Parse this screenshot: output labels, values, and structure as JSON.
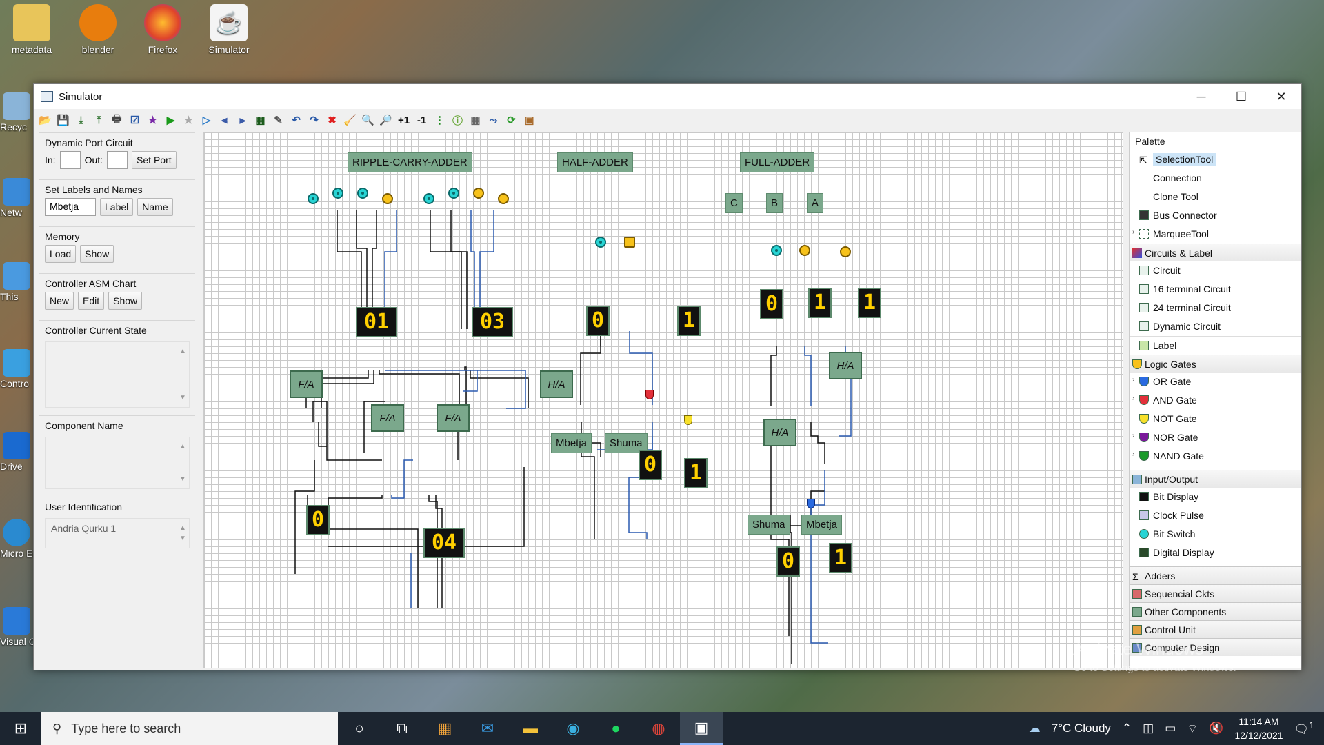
{
  "desktop": {
    "icons": [
      "metadata",
      "blender",
      "Firefox",
      "Simulator"
    ],
    "side_icons": [
      "Recyc",
      "Netw",
      "This",
      "Contro",
      "Drive",
      "Micro Ed",
      "Visual Co"
    ]
  },
  "window": {
    "title": "Simulator",
    "minimize": "─",
    "maximize": "☐",
    "close": "✕"
  },
  "toolbar": {
    "icons": [
      "open-icon",
      "save-icon",
      "export-icon",
      "import-icon",
      "print-icon",
      "check-icon",
      "star-icon",
      "run-icon",
      "star-gray-icon",
      "step-icon",
      "align-left-icon",
      "align-right-icon",
      "monitor-icon",
      "edit-icon",
      "undo-icon",
      "redo-icon",
      "delete-icon",
      "clear-icon",
      "zoom-in-icon",
      "zoom-out-icon",
      "plus-one-icon",
      "minus-one-icon",
      "timing-icon",
      "info-icon",
      "grid-icon",
      "route-icon",
      "refresh-icon",
      "chip-icon"
    ],
    "glyphs": [
      "📂",
      "💾",
      "⤓",
      "⤒",
      "🖶",
      "☑",
      "★",
      "▶",
      "★",
      "▷",
      "⫷",
      "⫸",
      "▦",
      "✎",
      "↶",
      "↷",
      "✖",
      "🧹",
      "🔍",
      "🔎",
      "+1",
      "-1",
      "⋮",
      "ⓘ",
      "▦",
      "⤳",
      "⟳",
      "▣"
    ],
    "colors": [
      "#c9a04a",
      "#3a6aa8",
      "#3a7a3a",
      "#3a7a3a",
      "#444",
      "#2a5aa8",
      "#7a2aa8",
      "#1a9a1a",
      "#aaa",
      "#2a7ac8",
      "#3a5aa8",
      "#3a5aa8",
      "#1a5a1a",
      "#555",
      "#2a5aa8",
      "#2a5aa8",
      "#e02020",
      "#d0a020",
      "#2a5aa8",
      "#2a5aa8",
      "#111",
      "#111",
      "#1a8a1a",
      "#6aa83a",
      "#666",
      "#2a5aa8",
      "#2a9a2a",
      "#a86a2a"
    ]
  },
  "left": {
    "dynamic_port": {
      "title": "Dynamic Port Circuit",
      "in_label": "In:",
      "in_value": "",
      "out_label": "Out:",
      "out_value": "",
      "set_port": "Set Port"
    },
    "labels": {
      "title": "Set Labels and Names",
      "value": "Mbetja",
      "label_btn": "Label",
      "name_btn": "Name"
    },
    "memory": {
      "title": "Memory",
      "load": "Load",
      "show": "Show"
    },
    "asm": {
      "title": "Controller ASM Chart",
      "new": "New",
      "edit": "Edit",
      "show": "Show"
    },
    "state": {
      "title": "Controller Current State",
      "value": ""
    },
    "component": {
      "title": "Component Name",
      "value": ""
    },
    "user": {
      "title": "User Identification",
      "value": "Andria Qurku 1"
    }
  },
  "canvas": {
    "labels": {
      "rca": "RIPPLE-CARRY-ADDER",
      "ha": "HALF-ADDER",
      "fa": "FULL-ADDER",
      "c": "C",
      "b": "B",
      "a": "A",
      "ha_out1": "Mbetja",
      "ha_out2": "Shuma",
      "fa_out1": "Shuma",
      "fa_out2": "Mbetja"
    },
    "displays": {
      "rca_in1": "01",
      "rca_in2": "03",
      "rca_carry": "0",
      "rca_sum": "04",
      "ha_in1": "0",
      "ha_in2": "1",
      "ha_out1": "0",
      "ha_out2": "1",
      "fa_in1": "0",
      "fa_in2": "1",
      "fa_in3": "1",
      "fa_out1": "0",
      "fa_out2": "1"
    },
    "blocks": {
      "fa": "F/A",
      "ha": "H/A"
    }
  },
  "palette": {
    "title": "Palette",
    "tools": [
      "SelectionTool",
      "Connection",
      "Clone Tool",
      "Bus Connector",
      "MarqueeTool"
    ],
    "circuits": {
      "title": "Circuits & Label",
      "items": [
        "Circuit",
        "16 terminal Circuit",
        "24 terminal Circuit",
        "Dynamic Circuit",
        "Label"
      ]
    },
    "gates": {
      "title": "Logic Gates",
      "items": [
        "OR Gate",
        "AND Gate",
        "NOT Gate",
        "NOR Gate",
        "NAND Gate"
      ]
    },
    "io": {
      "title": "Input/Output",
      "items": [
        "Bit Display",
        "Clock Pulse",
        "Bit Switch",
        "Digital Display"
      ]
    },
    "more": [
      "Adders",
      "Sequencial Ckts",
      "Other Components",
      "Control Unit",
      "Computer Design"
    ]
  },
  "watermark": {
    "line1": "Activate Windows",
    "line2": "Go to Settings to activate Windows."
  },
  "taskbar": {
    "search_placeholder": "Type here to search",
    "weather": "7°C  Cloudy",
    "time": "11:14 AM",
    "date": "12/12/2021",
    "notifications": "1"
  }
}
